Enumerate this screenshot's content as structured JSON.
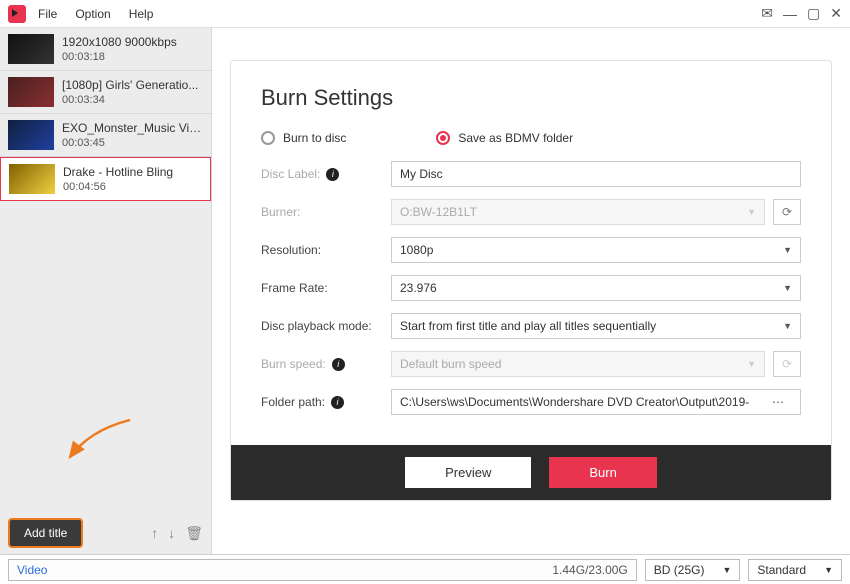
{
  "menu": {
    "file": "File",
    "option": "Option",
    "help": "Help"
  },
  "sidebar": {
    "items": [
      {
        "title": "1920x1080 9000kbps",
        "duration": "00:03:18"
      },
      {
        "title": "[1080p] Girls' Generatio...",
        "duration": "00:03:34"
      },
      {
        "title": "EXO_Monster_Music Video",
        "duration": "00:03:45"
      },
      {
        "title": "Drake - Hotline Bling",
        "duration": "00:04:56"
      }
    ],
    "add_title_label": "Add title"
  },
  "settings": {
    "title": "Burn Settings",
    "radio": {
      "burn_to_disc": "Burn to disc",
      "save_bdmv": "Save as BDMV folder"
    },
    "labels": {
      "disc_label": "Disc Label:",
      "burner": "Burner:",
      "resolution": "Resolution:",
      "frame_rate": "Frame Rate:",
      "playback_mode": "Disc playback mode:",
      "burn_speed": "Burn speed:",
      "folder_path": "Folder path:"
    },
    "values": {
      "disc_label": "My Disc",
      "burner": "O:BW-12B1LT",
      "resolution": "1080p",
      "frame_rate": "23.976",
      "playback_mode": "Start from first title and play all titles sequentially",
      "burn_speed": "Default burn speed",
      "folder_path": "C:\\Users\\ws\\Documents\\Wondershare DVD Creator\\Output\\2019-"
    },
    "buttons": {
      "preview": "Preview",
      "burn": "Burn"
    }
  },
  "statusbar": {
    "video_label": "Video",
    "size": "1.44G/23.00G",
    "disc_type": "BD (25G)",
    "quality": "Standard"
  }
}
